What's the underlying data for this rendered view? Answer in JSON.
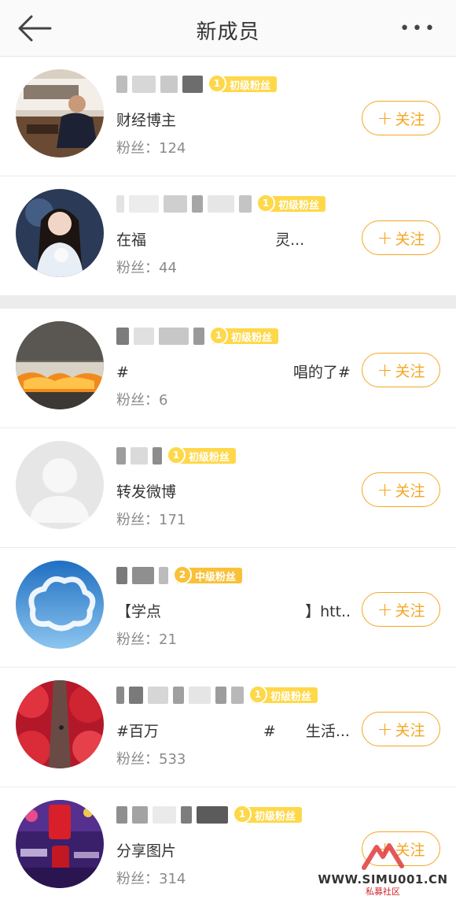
{
  "header": {
    "title": "新成员",
    "back_icon": "back-arrow-icon",
    "more_icon": "more-dots-icon",
    "more_text": "•••"
  },
  "members": [
    {
      "name": "",
      "badge_level": "1",
      "badge_text": "初级粉丝",
      "description": "财经博主",
      "fans": "粉丝：124",
      "follow_label": "关注"
    },
    {
      "name": "",
      "badge_level": "1",
      "badge_text": "初级粉丝",
      "description": "在福 　　　　　　　　 灵...",
      "fans": "粉丝：44",
      "follow_label": "关注"
    },
    {
      "name": "",
      "badge_level": "1",
      "badge_text": "初级粉丝",
      "description": "#　　　　　　　　　　　唱的了#",
      "fans": "粉丝：6",
      "follow_label": "关注"
    },
    {
      "name": "",
      "badge_level": "1",
      "badge_text": "初级粉丝",
      "description": "转发微博",
      "fans": "粉丝：171",
      "follow_label": "关注"
    },
    {
      "name": "",
      "badge_level": "2",
      "badge_text": "中级粉丝",
      "description": "【学点 　　　　　　　　　 】htt...",
      "fans": "粉丝：21",
      "follow_label": "关注"
    },
    {
      "name": "",
      "badge_level": "1",
      "badge_text": "初级粉丝",
      "description": "#百万　　　　　　　#　　生活...",
      "fans": "粉丝：533",
      "follow_label": "关注"
    },
    {
      "name": "",
      "badge_level": "1",
      "badge_text": "初级粉丝",
      "description": "分享图片",
      "fans": "粉丝：314",
      "follow_label": "关注"
    }
  ],
  "watermark": {
    "site": "WWW.SIMU001.CN",
    "label": "私募社区"
  },
  "colors": {
    "accent": "#f5a623",
    "badge": "#fed84a",
    "text": "#333333",
    "muted": "#8a8a8a"
  }
}
